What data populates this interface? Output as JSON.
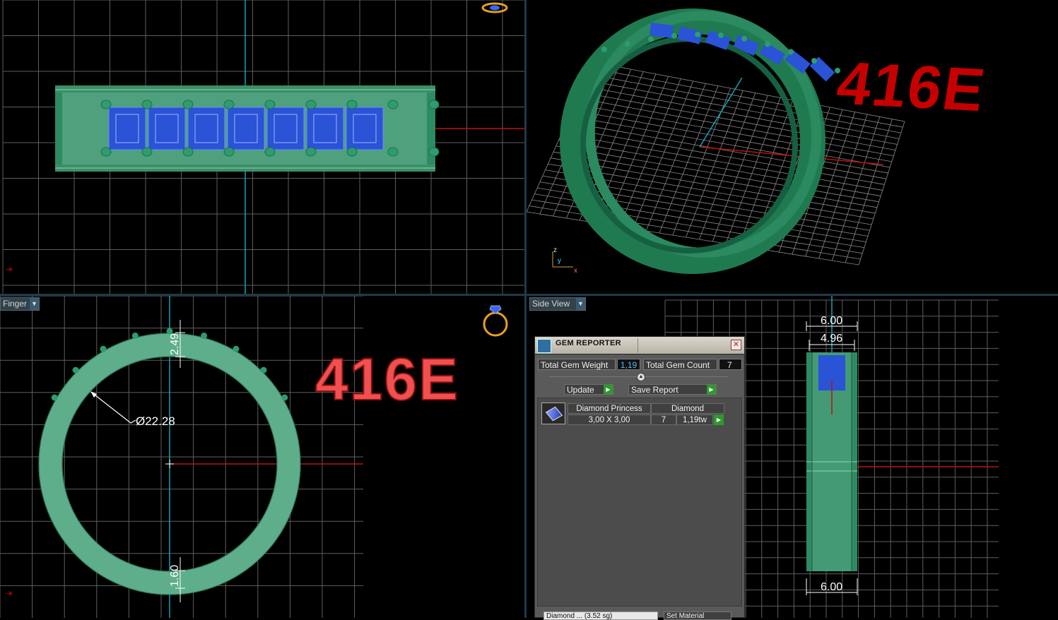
{
  "viewports": {
    "top_left": {
      "axis": "x"
    },
    "top_right": {
      "axis_z": "z",
      "axis_y": "y",
      "axis_x": "x",
      "stamp": "416E",
      "stamp_color": "#c40000"
    },
    "bottom_left": {
      "label": "Finger",
      "stamp": "416E",
      "stamp_color": "#f05050",
      "diameter": "Ø22.28",
      "top_thickness": "2.49",
      "bottom_thickness": "1.60",
      "axis": "x"
    },
    "bottom_right": {
      "label": "Side View",
      "width_top": "6.00",
      "gem_width": "4.96",
      "width_bottom": "6.00"
    }
  },
  "gem_reporter": {
    "title": "GEM REPORTER",
    "close": "✕",
    "total_weight_label": "Total Gem Weight",
    "total_weight_value": "1,19",
    "total_count_label": "Total Gem Count",
    "total_count_value": "7",
    "update_label": "Update",
    "save_label": "Save Report",
    "gem": {
      "shape": "Diamond Princess",
      "material": "Diamond",
      "size": "3,00 X 3,00",
      "count": "7",
      "weight": "1,19tw"
    },
    "footer_material": "Diamond ... (3.52 sg)",
    "footer_button": "Set Material"
  },
  "colors": {
    "ring": "#2e8a61",
    "ring_light": "#5fae8b",
    "gem": "#2a53d6",
    "axis_red": "#c01010",
    "axis_teal": "#14a3b8"
  }
}
